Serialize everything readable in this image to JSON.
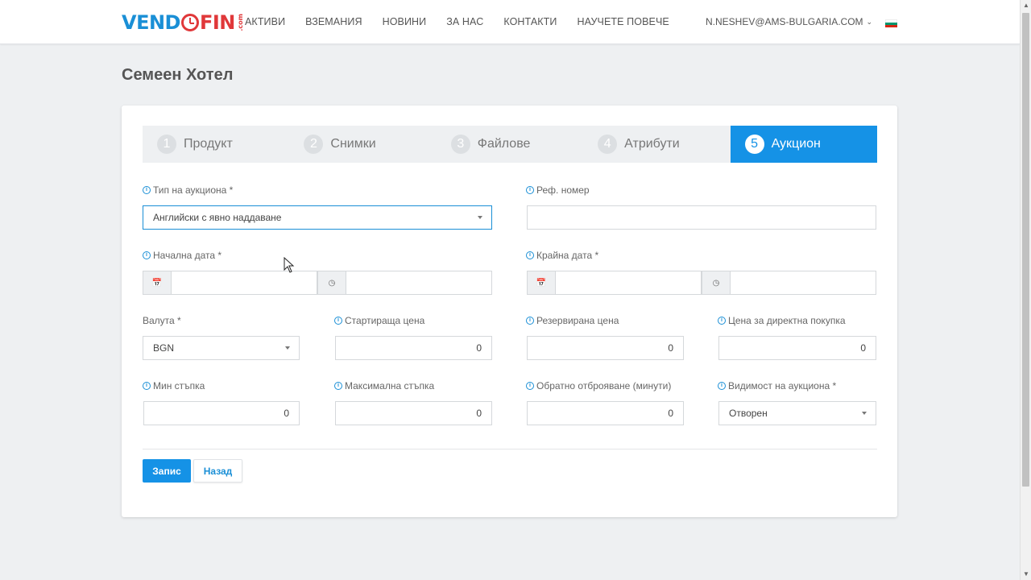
{
  "brand": {
    "logo_left": "VEND",
    "logo_right": "FIN",
    "logo_suffix": ".com"
  },
  "nav": {
    "items": [
      "АКТИВИ",
      "ВЗЕМАНИЯ",
      "НОВИНИ",
      "ЗА НАС",
      "КОНТАКТИ",
      "НАУЧЕТЕ ПОВЕЧЕ"
    ],
    "user_email": "N.NESHEV@AMS-BULGARIA.COM",
    "language_flag": "bulgarian-flag-icon"
  },
  "page": {
    "title": "Семеен Хотел"
  },
  "steps": [
    {
      "num": "1",
      "label": "Продукт"
    },
    {
      "num": "2",
      "label": "Снимки"
    },
    {
      "num": "3",
      "label": "Файлове"
    },
    {
      "num": "4",
      "label": "Атрибути"
    },
    {
      "num": "5",
      "label": "Аукцион",
      "active": true
    }
  ],
  "form": {
    "auction_type": {
      "label": "Тип на аукциона *",
      "value": "Английски с явно наддаване"
    },
    "ref_number": {
      "label": "Реф. номер",
      "value": ""
    },
    "start_date": {
      "label": "Начална дата *",
      "date": "",
      "time": ""
    },
    "end_date": {
      "label": "Крайна дата *",
      "date": "",
      "time": ""
    },
    "currency": {
      "label": "Валута *",
      "value": "BGN"
    },
    "start_price": {
      "label": "Стартираща цена",
      "value": "0"
    },
    "reserve_price": {
      "label": "Резервирана цена",
      "value": "0"
    },
    "buy_now_price": {
      "label": "Цена за директна покупка",
      "value": "0"
    },
    "min_step": {
      "label": "Мин стъпка",
      "value": "0"
    },
    "max_step": {
      "label": "Максимална стъпка",
      "value": "0"
    },
    "countdown": {
      "label": "Обратно отброяване (минути)",
      "value": "0"
    },
    "visibility": {
      "label": "Видимост на аукциона *",
      "value": "Отворен"
    }
  },
  "buttons": {
    "save": "Запис",
    "back": "Назад"
  },
  "colors": {
    "primary": "#1592e6",
    "brand_red": "#e0383a",
    "background": "#eef0f2"
  }
}
